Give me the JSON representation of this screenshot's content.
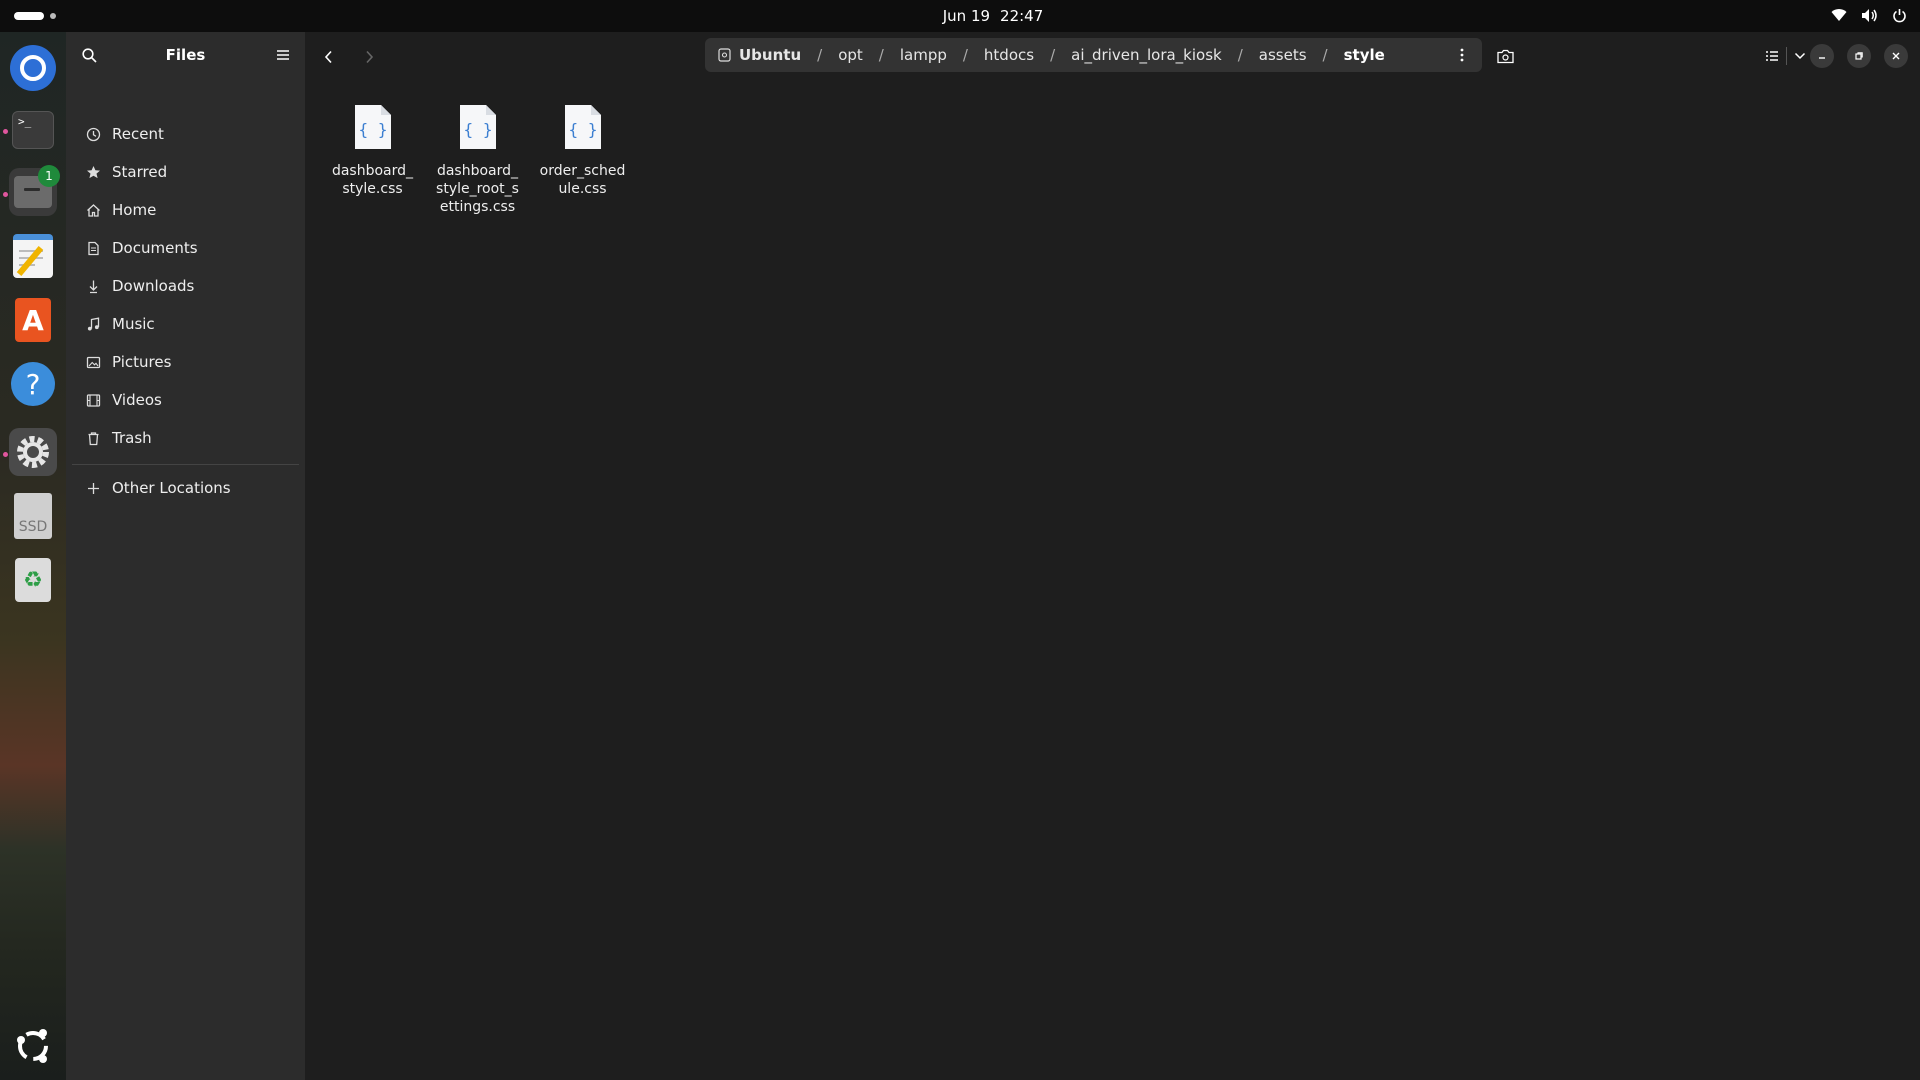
{
  "topbar": {
    "date": "Jun 19",
    "time": "22:47",
    "tray_icons": [
      "wifi-icon",
      "volume-icon",
      "power-icon"
    ]
  },
  "dock": {
    "items": [
      {
        "name": "chromium",
        "icon": "browser-icon",
        "running": false
      },
      {
        "name": "terminal",
        "icon": "terminal-icon",
        "running": true
      },
      {
        "name": "files",
        "icon": "files-icon",
        "running": true,
        "badge": "1"
      },
      {
        "name": "text-editor",
        "icon": "text-editor-icon",
        "running": false
      },
      {
        "name": "app-center",
        "icon": "app-center-icon",
        "running": false
      },
      {
        "name": "help",
        "icon": "help-icon",
        "running": false
      },
      {
        "name": "settings",
        "icon": "settings-icon",
        "running": true
      },
      {
        "name": "ssd-drive",
        "icon": "drive-icon",
        "label": "SSD",
        "running": false
      },
      {
        "name": "trash",
        "icon": "trash-icon",
        "running": false
      }
    ],
    "show_apps_icon": "ubuntu-logo-icon"
  },
  "sidebar": {
    "title": "Files",
    "places": [
      {
        "label": "Recent",
        "icon": "clock-icon"
      },
      {
        "label": "Starred",
        "icon": "star-icon"
      },
      {
        "label": "Home",
        "icon": "home-icon"
      },
      {
        "label": "Documents",
        "icon": "document-icon"
      },
      {
        "label": "Downloads",
        "icon": "download-icon"
      },
      {
        "label": "Music",
        "icon": "music-icon"
      },
      {
        "label": "Pictures",
        "icon": "picture-icon"
      },
      {
        "label": "Videos",
        "icon": "video-icon"
      },
      {
        "label": "Trash",
        "icon": "trash-icon"
      }
    ],
    "other_locations": "Other Locations"
  },
  "pathbar": {
    "crumbs": [
      "Ubuntu",
      "opt",
      "lampp",
      "htdocs",
      "ai_driven_lora_kiosk",
      "assets",
      "style"
    ]
  },
  "files": [
    {
      "name": "dashboard_\nstyle.css"
    },
    {
      "name": "dashboard_\nstyle_root_s\nettings.css"
    },
    {
      "name": "order_sched\nule.css"
    }
  ],
  "colors": {
    "window_bg": "#1e1e1e",
    "sidebar_bg": "#2c2c2c",
    "pathbar_bg": "#333333",
    "file_icon_accent": "#3c7fd1",
    "badge": "#1f8a3b"
  }
}
